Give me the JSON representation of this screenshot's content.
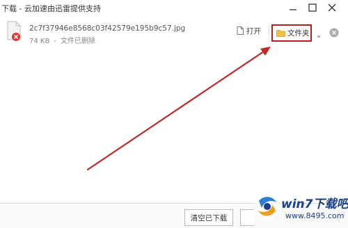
{
  "window": {
    "title": "下载 - 云加速由迅雷提供支持"
  },
  "download": {
    "filename": "2c7f37946e8568c03f42579e195b9c57.jpg",
    "size": "74 KB",
    "separator": "-",
    "status": "文件已删除"
  },
  "actions": {
    "open_label": "打开",
    "folder_label": "文件夹"
  },
  "footer": {
    "clear_label": "清空已下载"
  },
  "watermark": {
    "brand": "win7下载吧",
    "url": "www.8495.com"
  },
  "colors": {
    "highlight": "#b02020",
    "arrow": "#c0282a",
    "folder": "#f0c040",
    "remove_icon": "#aaaaaa"
  }
}
